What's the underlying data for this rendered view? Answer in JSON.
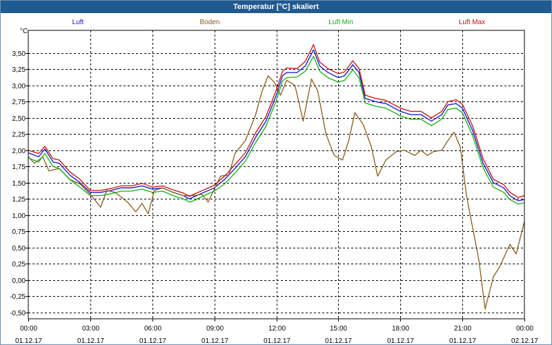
{
  "window": {
    "title": "Temperatur [°C] skaliert"
  },
  "colors": {
    "titlebar": "#1f5a91",
    "luft": "#1010c8",
    "boden": "#8a5a18",
    "luft_min": "#10b010",
    "luft_max": "#c01010"
  },
  "chart_data": {
    "type": "line",
    "title": "Temperatur [°C] skaliert",
    "ylabel": "°C",
    "ylim": [
      -0.6,
      3.85
    ],
    "grid": true,
    "legend_position": "top",
    "yticks": [
      "3,50",
      "3,25",
      "3,00",
      "2,75",
      "2,50",
      "2,25",
      "2,00",
      "1,75",
      "1,50",
      "1,25",
      "1,00",
      "0,75",
      "0,50",
      "0,25",
      "0,00",
      "-0,25",
      "-0,50"
    ],
    "ytick_values": [
      3.5,
      3.25,
      3.0,
      2.75,
      2.5,
      2.25,
      2.0,
      1.75,
      1.5,
      1.25,
      1.0,
      0.75,
      0.5,
      0.25,
      0.0,
      -0.25,
      -0.5
    ],
    "xticks": [
      {
        "time": "00:00",
        "date": "01.12.17"
      },
      {
        "time": "03:00",
        "date": "01.12.17"
      },
      {
        "time": "06:00",
        "date": "01.12.17"
      },
      {
        "time": "09:00",
        "date": "01.12.17"
      },
      {
        "time": "12:00",
        "date": "01.12.17"
      },
      {
        "time": "15:00",
        "date": "01.12.17"
      },
      {
        "time": "18:00",
        "date": "01.12.17"
      },
      {
        "time": "21:00",
        "date": "01.12.17"
      },
      {
        "time": "00:00",
        "date": "02.12.17"
      }
    ],
    "xtick_hours": [
      0,
      3,
      6,
      9,
      12,
      15,
      18,
      21,
      24
    ],
    "series": [
      {
        "name": "Luft",
        "color": "#1010c8",
        "points": [
          [
            0,
            1.96
          ],
          [
            0.5,
            1.9
          ],
          [
            0.8,
            2.02
          ],
          [
            1.2,
            1.82
          ],
          [
            1.5,
            1.8
          ],
          [
            2.0,
            1.62
          ],
          [
            2.5,
            1.5
          ],
          [
            3.0,
            1.35
          ],
          [
            3.5,
            1.35
          ],
          [
            4.0,
            1.38
          ],
          [
            4.5,
            1.42
          ],
          [
            5.0,
            1.42
          ],
          [
            5.5,
            1.45
          ],
          [
            6.0,
            1.4
          ],
          [
            6.5,
            1.42
          ],
          [
            7.0,
            1.35
          ],
          [
            7.5,
            1.3
          ],
          [
            7.8,
            1.25
          ],
          [
            8.0,
            1.28
          ],
          [
            8.5,
            1.35
          ],
          [
            9.0,
            1.42
          ],
          [
            9.5,
            1.55
          ],
          [
            10.0,
            1.72
          ],
          [
            10.5,
            1.9
          ],
          [
            11.0,
            2.2
          ],
          [
            11.5,
            2.45
          ],
          [
            12.0,
            2.85
          ],
          [
            12.3,
            3.15
          ],
          [
            12.5,
            3.2
          ],
          [
            13.0,
            3.2
          ],
          [
            13.4,
            3.3
          ],
          [
            13.8,
            3.55
          ],
          [
            14.1,
            3.3
          ],
          [
            14.5,
            3.2
          ],
          [
            15.0,
            3.12
          ],
          [
            15.3,
            3.15
          ],
          [
            15.7,
            3.32
          ],
          [
            16.0,
            3.2
          ],
          [
            16.3,
            2.8
          ],
          [
            16.8,
            2.75
          ],
          [
            17.3,
            2.72
          ],
          [
            18.0,
            2.6
          ],
          [
            18.5,
            2.55
          ],
          [
            19.0,
            2.55
          ],
          [
            19.5,
            2.45
          ],
          [
            20.0,
            2.55
          ],
          [
            20.3,
            2.7
          ],
          [
            20.7,
            2.72
          ],
          [
            21.0,
            2.65
          ],
          [
            21.5,
            2.3
          ],
          [
            22.0,
            1.8
          ],
          [
            22.5,
            1.5
          ],
          [
            23.0,
            1.42
          ],
          [
            23.3,
            1.3
          ],
          [
            23.7,
            1.22
          ],
          [
            24.0,
            1.24
          ]
        ]
      },
      {
        "name": "Boden",
        "color": "#8a5a18",
        "points": [
          [
            0,
            1.9
          ],
          [
            0.3,
            1.8
          ],
          [
            0.7,
            1.9
          ],
          [
            1.0,
            1.68
          ],
          [
            1.5,
            1.72
          ],
          [
            2.0,
            1.55
          ],
          [
            2.5,
            1.48
          ],
          [
            3.0,
            1.32
          ],
          [
            3.5,
            1.12
          ],
          [
            3.8,
            1.38
          ],
          [
            4.2,
            1.35
          ],
          [
            4.8,
            1.2
          ],
          [
            5.2,
            1.05
          ],
          [
            5.5,
            1.18
          ],
          [
            5.8,
            1.02
          ],
          [
            6.1,
            1.38
          ],
          [
            6.5,
            1.42
          ],
          [
            7.0,
            1.35
          ],
          [
            7.5,
            1.3
          ],
          [
            8.0,
            1.3
          ],
          [
            8.4,
            1.32
          ],
          [
            8.7,
            1.2
          ],
          [
            9.0,
            1.4
          ],
          [
            9.3,
            1.6
          ],
          [
            9.7,
            1.62
          ],
          [
            10.0,
            1.95
          ],
          [
            10.5,
            2.15
          ],
          [
            11.0,
            2.55
          ],
          [
            11.3,
            2.9
          ],
          [
            11.6,
            3.15
          ],
          [
            11.9,
            3.05
          ],
          [
            12.2,
            2.85
          ],
          [
            12.5,
            3.08
          ],
          [
            12.9,
            3.0
          ],
          [
            13.3,
            2.45
          ],
          [
            13.7,
            3.1
          ],
          [
            14.0,
            2.92
          ],
          [
            14.4,
            2.25
          ],
          [
            14.8,
            1.92
          ],
          [
            15.2,
            1.85
          ],
          [
            15.5,
            2.15
          ],
          [
            15.8,
            2.58
          ],
          [
            16.2,
            2.4
          ],
          [
            16.6,
            2.05
          ],
          [
            16.9,
            1.6
          ],
          [
            17.3,
            1.85
          ],
          [
            17.8,
            1.98
          ],
          [
            18.2,
            2.0
          ],
          [
            18.7,
            1.92
          ],
          [
            19.0,
            2.0
          ],
          [
            19.3,
            1.92
          ],
          [
            19.6,
            1.98
          ],
          [
            20.0,
            2.0
          ],
          [
            20.3,
            2.15
          ],
          [
            20.6,
            2.28
          ],
          [
            20.9,
            2.05
          ],
          [
            21.2,
            1.3
          ],
          [
            21.5,
            0.8
          ],
          [
            21.8,
            0.3
          ],
          [
            22.1,
            -0.45
          ],
          [
            22.5,
            0.05
          ],
          [
            22.8,
            0.2
          ],
          [
            23.3,
            0.55
          ],
          [
            23.6,
            0.4
          ],
          [
            24.0,
            0.9
          ]
        ]
      },
      {
        "name": "Luft Min",
        "color": "#10b010",
        "points": [
          [
            0,
            1.88
          ],
          [
            0.5,
            1.82
          ],
          [
            0.8,
            1.95
          ],
          [
            1.2,
            1.75
          ],
          [
            1.5,
            1.72
          ],
          [
            2.0,
            1.55
          ],
          [
            2.5,
            1.43
          ],
          [
            3.0,
            1.3
          ],
          [
            3.5,
            1.3
          ],
          [
            4.0,
            1.33
          ],
          [
            4.5,
            1.37
          ],
          [
            5.0,
            1.37
          ],
          [
            5.5,
            1.4
          ],
          [
            6.0,
            1.35
          ],
          [
            6.5,
            1.37
          ],
          [
            7.0,
            1.3
          ],
          [
            7.5,
            1.25
          ],
          [
            7.8,
            1.2
          ],
          [
            8.0,
            1.22
          ],
          [
            8.5,
            1.3
          ],
          [
            9.0,
            1.37
          ],
          [
            9.5,
            1.48
          ],
          [
            10.0,
            1.65
          ],
          [
            10.5,
            1.83
          ],
          [
            11.0,
            2.12
          ],
          [
            11.5,
            2.37
          ],
          [
            12.0,
            2.77
          ],
          [
            12.3,
            3.07
          ],
          [
            12.5,
            3.12
          ],
          [
            13.0,
            3.13
          ],
          [
            13.4,
            3.22
          ],
          [
            13.8,
            3.45
          ],
          [
            14.1,
            3.22
          ],
          [
            14.5,
            3.12
          ],
          [
            15.0,
            3.05
          ],
          [
            15.3,
            3.08
          ],
          [
            15.7,
            3.24
          ],
          [
            16.0,
            3.12
          ],
          [
            16.3,
            2.73
          ],
          [
            16.8,
            2.68
          ],
          [
            17.3,
            2.65
          ],
          [
            18.0,
            2.53
          ],
          [
            18.5,
            2.48
          ],
          [
            19.0,
            2.48
          ],
          [
            19.5,
            2.38
          ],
          [
            20.0,
            2.48
          ],
          [
            20.3,
            2.63
          ],
          [
            20.7,
            2.65
          ],
          [
            21.0,
            2.58
          ],
          [
            21.5,
            2.22
          ],
          [
            22.0,
            1.73
          ],
          [
            22.5,
            1.43
          ],
          [
            23.0,
            1.35
          ],
          [
            23.3,
            1.24
          ],
          [
            23.7,
            1.17
          ],
          [
            24.0,
            1.19
          ]
        ]
      },
      {
        "name": "Luft Max",
        "color": "#c01010",
        "points": [
          [
            0,
            2.0
          ],
          [
            0.5,
            1.95
          ],
          [
            0.8,
            2.06
          ],
          [
            1.2,
            1.87
          ],
          [
            1.5,
            1.85
          ],
          [
            2.0,
            1.67
          ],
          [
            2.5,
            1.55
          ],
          [
            3.0,
            1.38
          ],
          [
            3.5,
            1.38
          ],
          [
            4.0,
            1.41
          ],
          [
            4.5,
            1.45
          ],
          [
            5.0,
            1.45
          ],
          [
            5.5,
            1.49
          ],
          [
            6.0,
            1.43
          ],
          [
            6.5,
            1.45
          ],
          [
            7.0,
            1.39
          ],
          [
            7.5,
            1.34
          ],
          [
            7.8,
            1.29
          ],
          [
            8.0,
            1.32
          ],
          [
            8.5,
            1.39
          ],
          [
            9.0,
            1.46
          ],
          [
            9.5,
            1.6
          ],
          [
            10.0,
            1.78
          ],
          [
            10.5,
            1.96
          ],
          [
            11.0,
            2.27
          ],
          [
            11.5,
            2.52
          ],
          [
            12.0,
            2.93
          ],
          [
            12.3,
            3.22
          ],
          [
            12.5,
            3.27
          ],
          [
            13.0,
            3.26
          ],
          [
            13.4,
            3.37
          ],
          [
            13.8,
            3.63
          ],
          [
            14.1,
            3.36
          ],
          [
            14.5,
            3.26
          ],
          [
            15.0,
            3.18
          ],
          [
            15.3,
            3.21
          ],
          [
            15.7,
            3.38
          ],
          [
            16.0,
            3.26
          ],
          [
            16.3,
            2.85
          ],
          [
            16.8,
            2.8
          ],
          [
            17.3,
            2.77
          ],
          [
            18.0,
            2.65
          ],
          [
            18.5,
            2.6
          ],
          [
            19.0,
            2.6
          ],
          [
            19.5,
            2.5
          ],
          [
            20.0,
            2.6
          ],
          [
            20.3,
            2.75
          ],
          [
            20.7,
            2.78
          ],
          [
            21.0,
            2.71
          ],
          [
            21.5,
            2.37
          ],
          [
            22.0,
            1.87
          ],
          [
            22.5,
            1.55
          ],
          [
            23.0,
            1.47
          ],
          [
            23.3,
            1.35
          ],
          [
            23.7,
            1.27
          ],
          [
            24.0,
            1.3
          ]
        ]
      }
    ]
  }
}
